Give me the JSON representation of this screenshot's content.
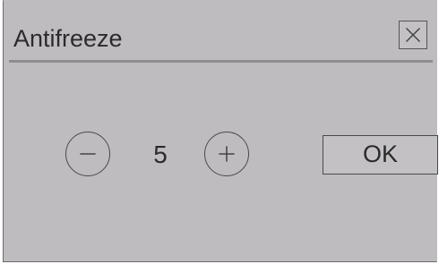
{
  "dialog": {
    "title": "Antifreeze",
    "close_icon": "close-icon",
    "stepper": {
      "minus_icon": "minus-circle-icon",
      "value": "5",
      "plus_icon": "plus-circle-icon"
    },
    "ok_label": "OK"
  },
  "colors": {
    "background": "#bfbcc0",
    "text": "#2b2b2b",
    "border": "#4a4a4a"
  }
}
